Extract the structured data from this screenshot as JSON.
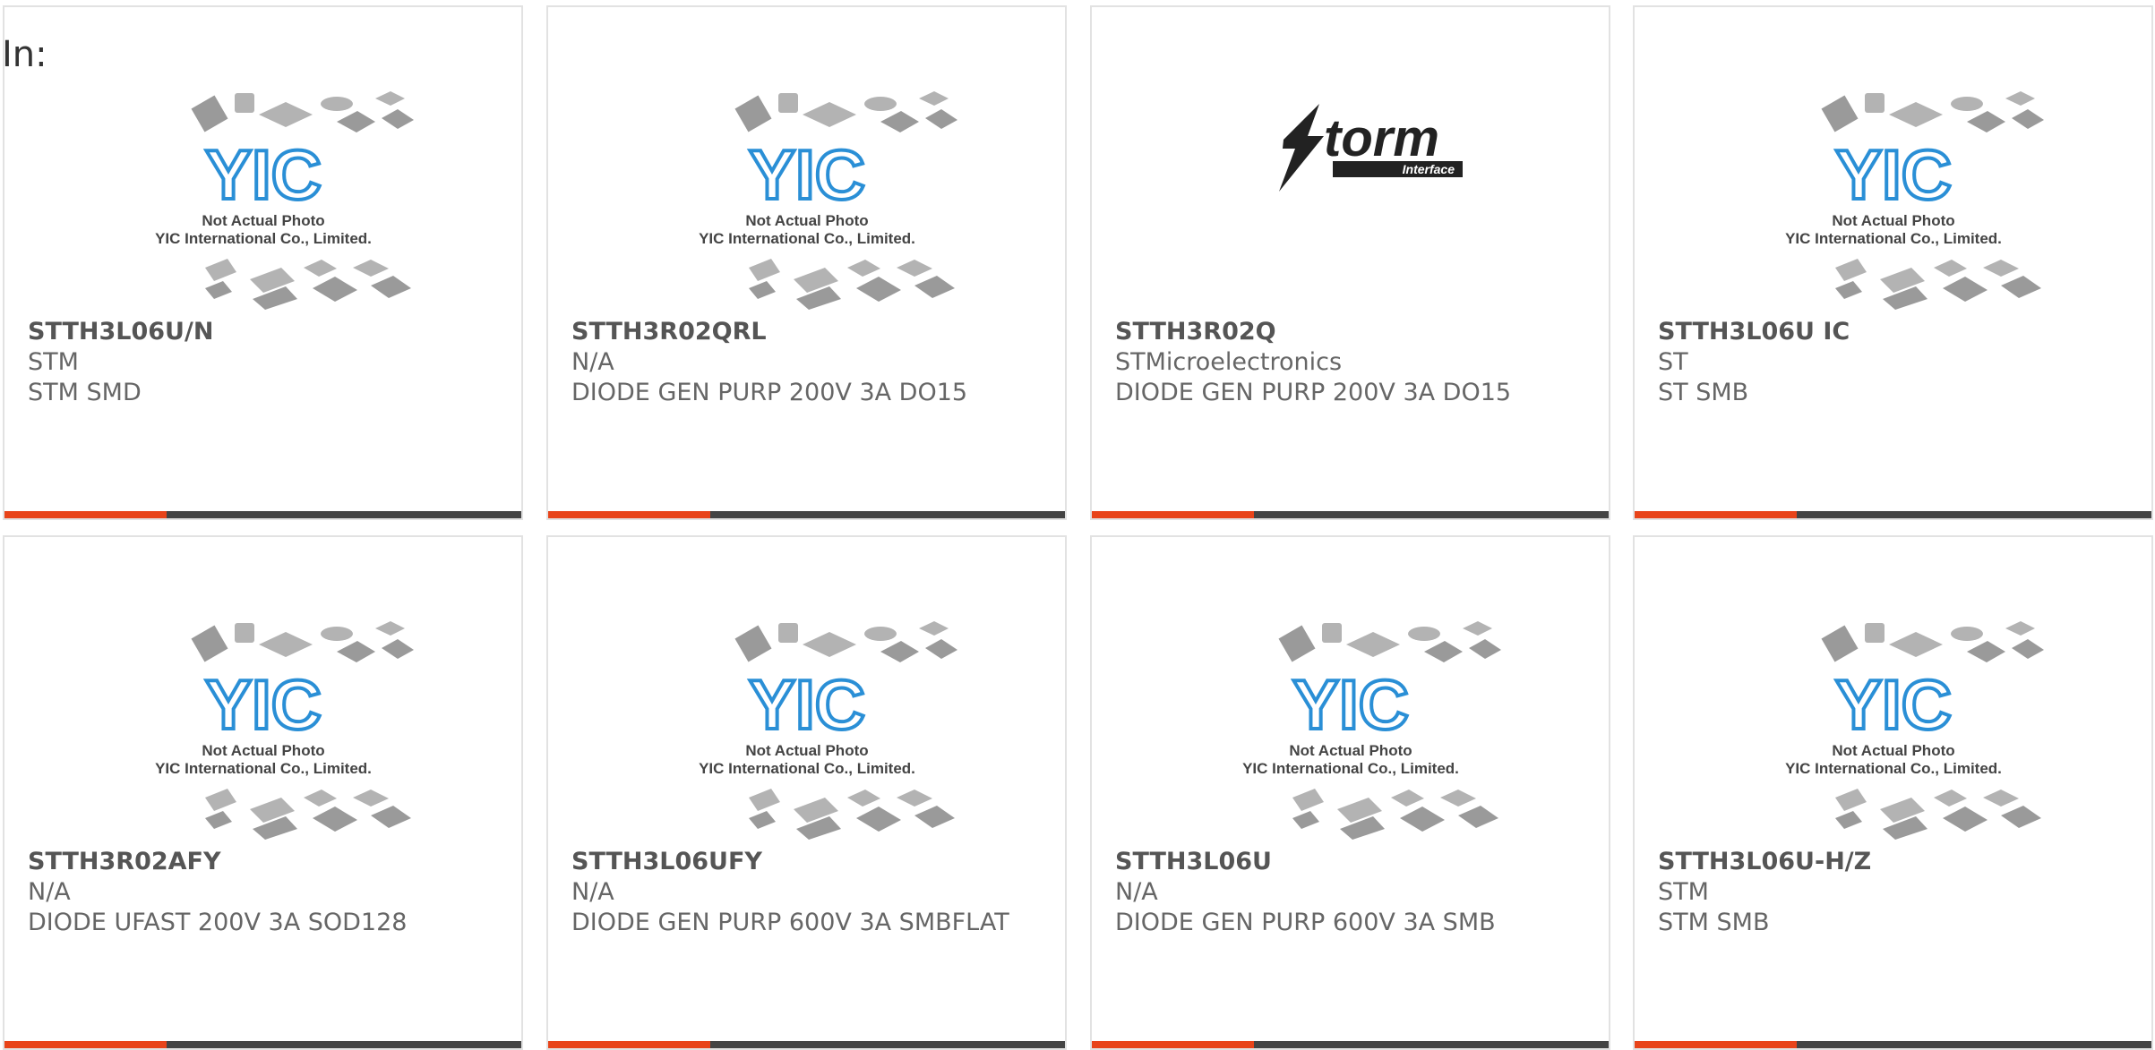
{
  "header": {
    "label": "In:"
  },
  "colors": {
    "accent": "#e8441a",
    "bar": "#444444",
    "border": "#e2e2e2",
    "text": "#666666"
  },
  "image_texts": {
    "yic_line1": "Not Actual Photo",
    "yic_line2": "YIC International Co., Limited.",
    "yic_logo": "YIC",
    "storm_logo": "Storm",
    "storm_sub": "Interface"
  },
  "products": [
    {
      "part": "STTH3L06U/N",
      "maker": "STM",
      "desc": "STM SMD",
      "image": "yic-placeholder"
    },
    {
      "part": "STTH3R02QRL",
      "maker": "N/A",
      "desc": "DIODE GEN PURP 200V 3A DO15",
      "image": "yic-placeholder"
    },
    {
      "part": "STTH3R02Q",
      "maker": "STMicroelectronics",
      "desc": "DIODE GEN PURP 200V 3A DO15",
      "image": "storm-logo"
    },
    {
      "part": "STTH3L06U IC",
      "maker": "ST",
      "desc": "ST SMB",
      "image": "yic-placeholder"
    },
    {
      "part": "STTH3R02AFY",
      "maker": "N/A",
      "desc": "DIODE UFAST 200V 3A SOD128",
      "image": "yic-placeholder"
    },
    {
      "part": "STTH3L06UFY",
      "maker": "N/A",
      "desc": "DIODE GEN PURP 600V 3A SMBFLAT",
      "image": "yic-placeholder"
    },
    {
      "part": "STTH3L06U",
      "maker": "N/A",
      "desc": "DIODE GEN PURP 600V 3A SMB",
      "image": "yic-placeholder"
    },
    {
      "part": "STTH3L06U-H/Z",
      "maker": "STM",
      "desc": "STM SMB",
      "image": "yic-placeholder"
    }
  ]
}
